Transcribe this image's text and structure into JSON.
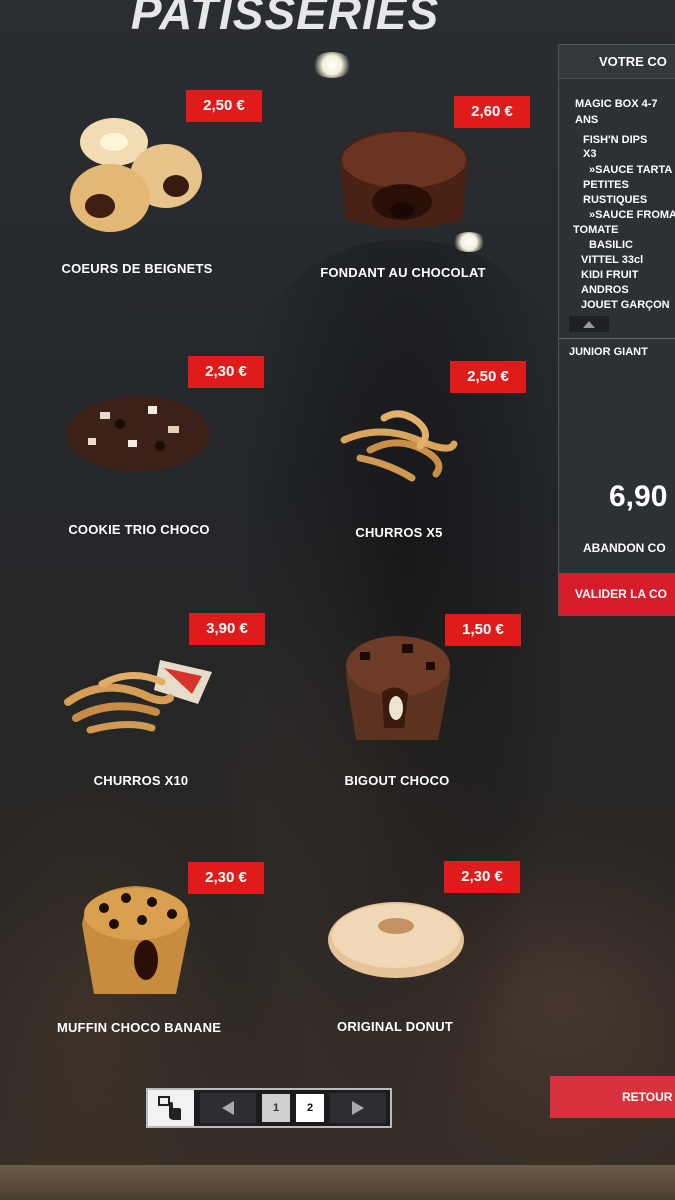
{
  "header": {
    "title": "PATISSERIES"
  },
  "products": [
    {
      "name": "COEURS DE BEIGNETS",
      "price": "2,50 €"
    },
    {
      "name": "FONDANT AU CHOCOLAT",
      "price": "2,60 €"
    },
    {
      "name": "COOKIE TRIO CHOCO",
      "price": "2,30 €"
    },
    {
      "name": "CHURROS X5",
      "price": "2,50 €"
    },
    {
      "name": "CHURROS X10",
      "price": "3,90 €"
    },
    {
      "name": "BIGOUT CHOCO",
      "price": "1,50 €"
    },
    {
      "name": "MUFFIN CHOCO BANANE",
      "price": "2,30 €"
    },
    {
      "name": "ORIGINAL DONUT",
      "price": "2,30 €"
    }
  ],
  "cart": {
    "header": "VOTRE CO",
    "lines": [
      "MAGIC BOX 4-7",
      "ANS",
      "FISH'N DIPS",
      "X3",
      "»SAUCE TARTA",
      "PETITES",
      "RUSTIQUES",
      "»SAUCE FROMA",
      "TOMATE",
      "BASILIC",
      "VITTEL 33cl",
      "KIDI FRUIT",
      "ANDROS",
      "JOUET GARÇON"
    ],
    "second_item": "JUNIOR GIANT",
    "total": "6,90",
    "abandon_label": "ABANDON CO",
    "validate_label": "VALIDER LA CO"
  },
  "retour_label": "RETOUR",
  "pager": {
    "pages": [
      "1",
      "2"
    ],
    "current": "2"
  },
  "colors": {
    "price_red": "#e01b1b",
    "validate_red": "#d81b2a",
    "background": "#23262a"
  }
}
